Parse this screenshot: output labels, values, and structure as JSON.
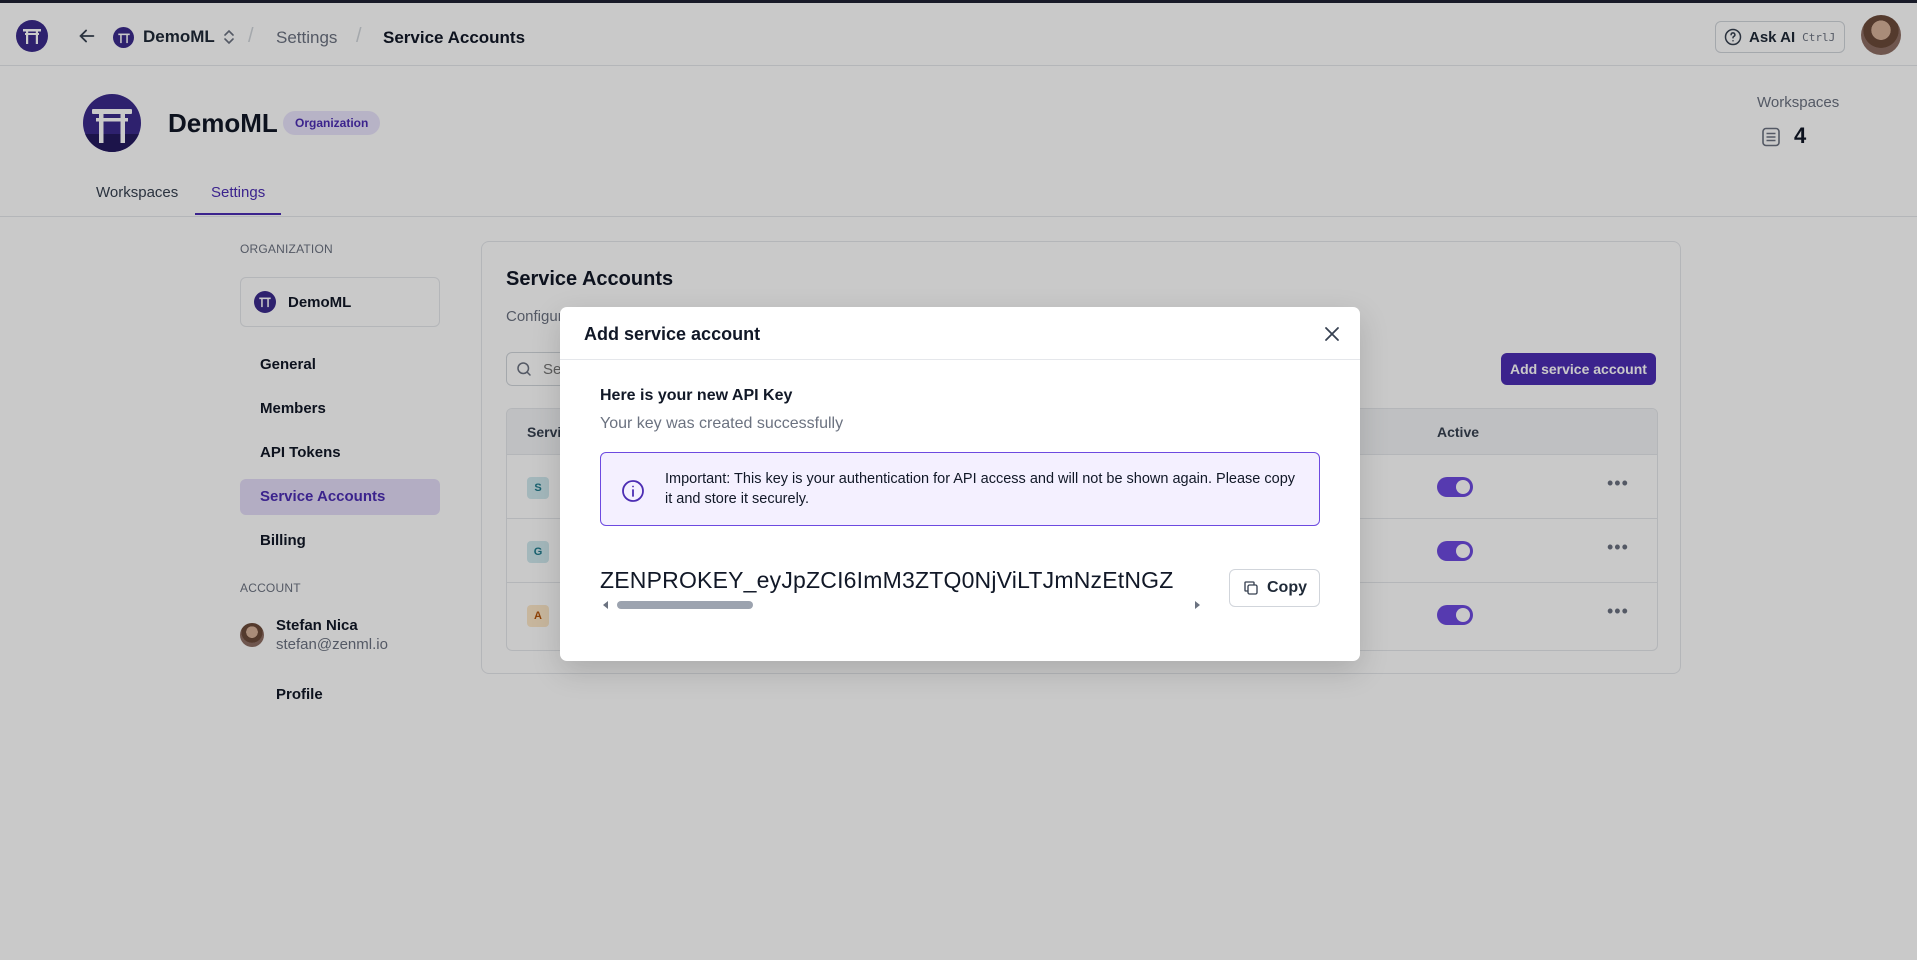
{
  "topbar": {
    "org_name": "DemoML",
    "crumb_settings": "Settings",
    "crumb_current": "Service Accounts",
    "ask_ai_label": "Ask AI",
    "ask_ai_shortcut": "CtrlJ"
  },
  "org_header": {
    "name": "DemoML",
    "badge": "Organization",
    "workspaces_label": "Workspaces",
    "workspaces_count": "4"
  },
  "tabs": [
    {
      "label": "Workspaces",
      "active": false
    },
    {
      "label": "Settings",
      "active": true
    }
  ],
  "sidebar": {
    "org_section_label": "ORGANIZATION",
    "org_name": "DemoML",
    "items": [
      {
        "label": "General"
      },
      {
        "label": "Members"
      },
      {
        "label": "API Tokens"
      },
      {
        "label": "Service Accounts",
        "active": true
      },
      {
        "label": "Billing"
      }
    ],
    "account_section_label": "ACCOUNT",
    "user_name": "Stefan Nica",
    "user_email": "stefan@zenml.io",
    "profile_label": "Profile"
  },
  "main": {
    "title": "Service Accounts",
    "subtitle": "Configur",
    "search_placeholder": "Se",
    "add_button": "Add service account",
    "columns": {
      "first": "Servi",
      "active": "Active"
    },
    "rows": [
      {
        "initial": "S",
        "color": "#cfe9ee",
        "text_color": "#1f7a8c",
        "active": true
      },
      {
        "initial": "G",
        "color": "#cfe9ee",
        "text_color": "#1f7a8c",
        "active": true
      },
      {
        "initial": "A",
        "color": "#fde7c7",
        "text_color": "#b45309",
        "active": true
      }
    ]
  },
  "modal": {
    "title": "Add service account",
    "heading": "Here is your new API Key",
    "subheading": "Your key was created successfully",
    "notice": "Important: This key is your authentication for API access and will not be shown again. Please copy it and store it securely.",
    "api_key": "ZENPROKEY_eyJpZCI6ImM3ZTQ0NjViLTJmNzEtNGZ",
    "copy_label": "Copy"
  },
  "colors": {
    "brand": "#4c2db3",
    "brand_light": "#e3dcf8",
    "toggle_on": "#6d4ae0"
  }
}
